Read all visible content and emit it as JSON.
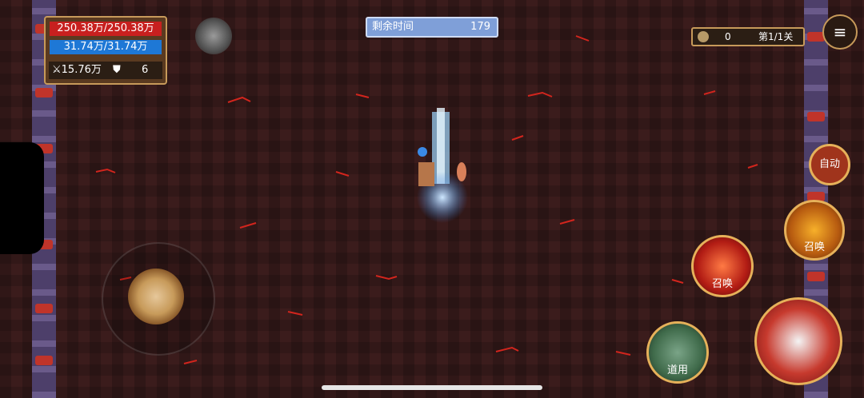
{
  "status": {
    "hp": "250.38万/250.38万",
    "mp": "31.74万/31.74万",
    "attack": "15.76万",
    "defense": "6"
  },
  "timer": {
    "label": "剩余时间",
    "value": "179"
  },
  "resources": {
    "coins": "0",
    "stage": "第1/1关"
  },
  "buttons": {
    "auto": "自动",
    "summon_top": "召唤",
    "summon_left": "召唤",
    "use": "道用"
  },
  "icons": {
    "menu": "menu-icon",
    "sword": "sword-icon",
    "shield": "shield-icon",
    "coin": "coin-icon"
  },
  "colors": {
    "hp_bar": "#c8201f",
    "mp_bar": "#1e78d6",
    "timer_bg": "#7f9fd8",
    "frame": "#c79a5a"
  }
}
